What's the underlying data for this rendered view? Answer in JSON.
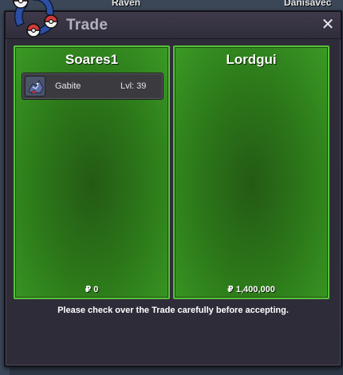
{
  "background": {
    "left_name": "Raven",
    "right_name": "Danisavec"
  },
  "window": {
    "title": "Trade",
    "close_label": "✕",
    "notice": "Please check over the Trade carefully before accepting."
  },
  "left_panel": {
    "player_name": "Soares1",
    "money": "₽ 0",
    "items": [
      {
        "name": "Gabite",
        "level": "Lvl: 39"
      }
    ]
  },
  "right_panel": {
    "player_name": "Lordgui",
    "money": "₽ 1,400,000"
  },
  "colors": {
    "panel_green": "#2d7b1a",
    "panel_border": "#57c23a",
    "window_bg": "#2f2c3a"
  },
  "icons": {
    "logo": "pokeball-logo-icon",
    "close": "close-icon",
    "pokemon": "gabite-icon"
  }
}
